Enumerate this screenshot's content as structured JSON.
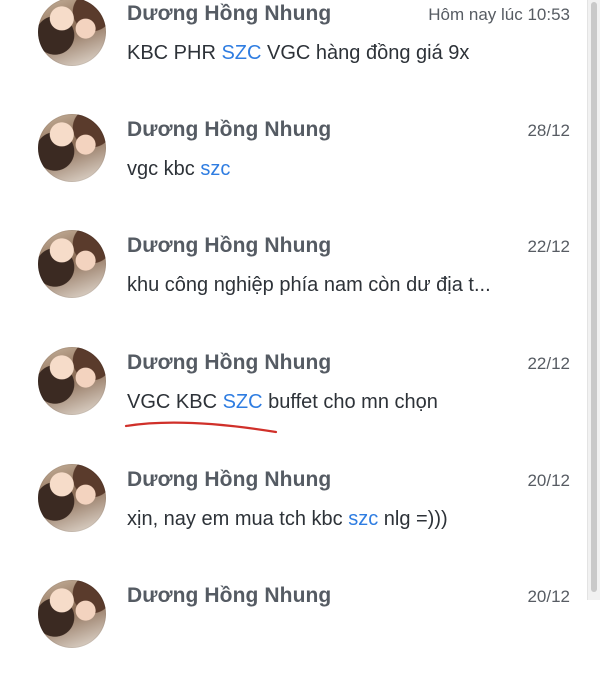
{
  "conversations": [
    {
      "name": "Dương Hồng Nhung",
      "time": "Hôm nay lúc 10:53",
      "message": [
        {
          "text": "KBC PHR ",
          "hl": false
        },
        {
          "text": "SZC",
          "hl": true
        },
        {
          "text": " VGC hàng đồng giá 9x",
          "hl": false
        }
      ]
    },
    {
      "name": "Dương Hồng Nhung",
      "time": "28/12",
      "message": [
        {
          "text": "vgc kbc ",
          "hl": false
        },
        {
          "text": "szc",
          "hl": true
        }
      ]
    },
    {
      "name": "Dương Hồng Nhung",
      "time": "22/12",
      "message": [
        {
          "text": "khu công nghiệp phía nam còn dư địa t...",
          "hl": false
        }
      ]
    },
    {
      "name": "Dương Hồng Nhung",
      "time": "22/12",
      "message": [
        {
          "text": "VGC KBC ",
          "hl": false
        },
        {
          "text": "SZC",
          "hl": true
        },
        {
          "text": " buffet cho mn chọn",
          "hl": false
        }
      ]
    },
    {
      "name": "Dương Hồng Nhung",
      "time": "20/12",
      "message": [
        {
          "text": "xịn, nay em mua tch kbc ",
          "hl": false
        },
        {
          "text": "szc",
          "hl": true
        },
        {
          "text": " nlg =)))",
          "hl": false
        }
      ]
    },
    {
      "name": "Dương Hồng Nhung",
      "time": "20/12",
      "message": []
    }
  ],
  "colors": {
    "highlight": "#2f7de1",
    "annotation_underline": "#d0302a"
  }
}
